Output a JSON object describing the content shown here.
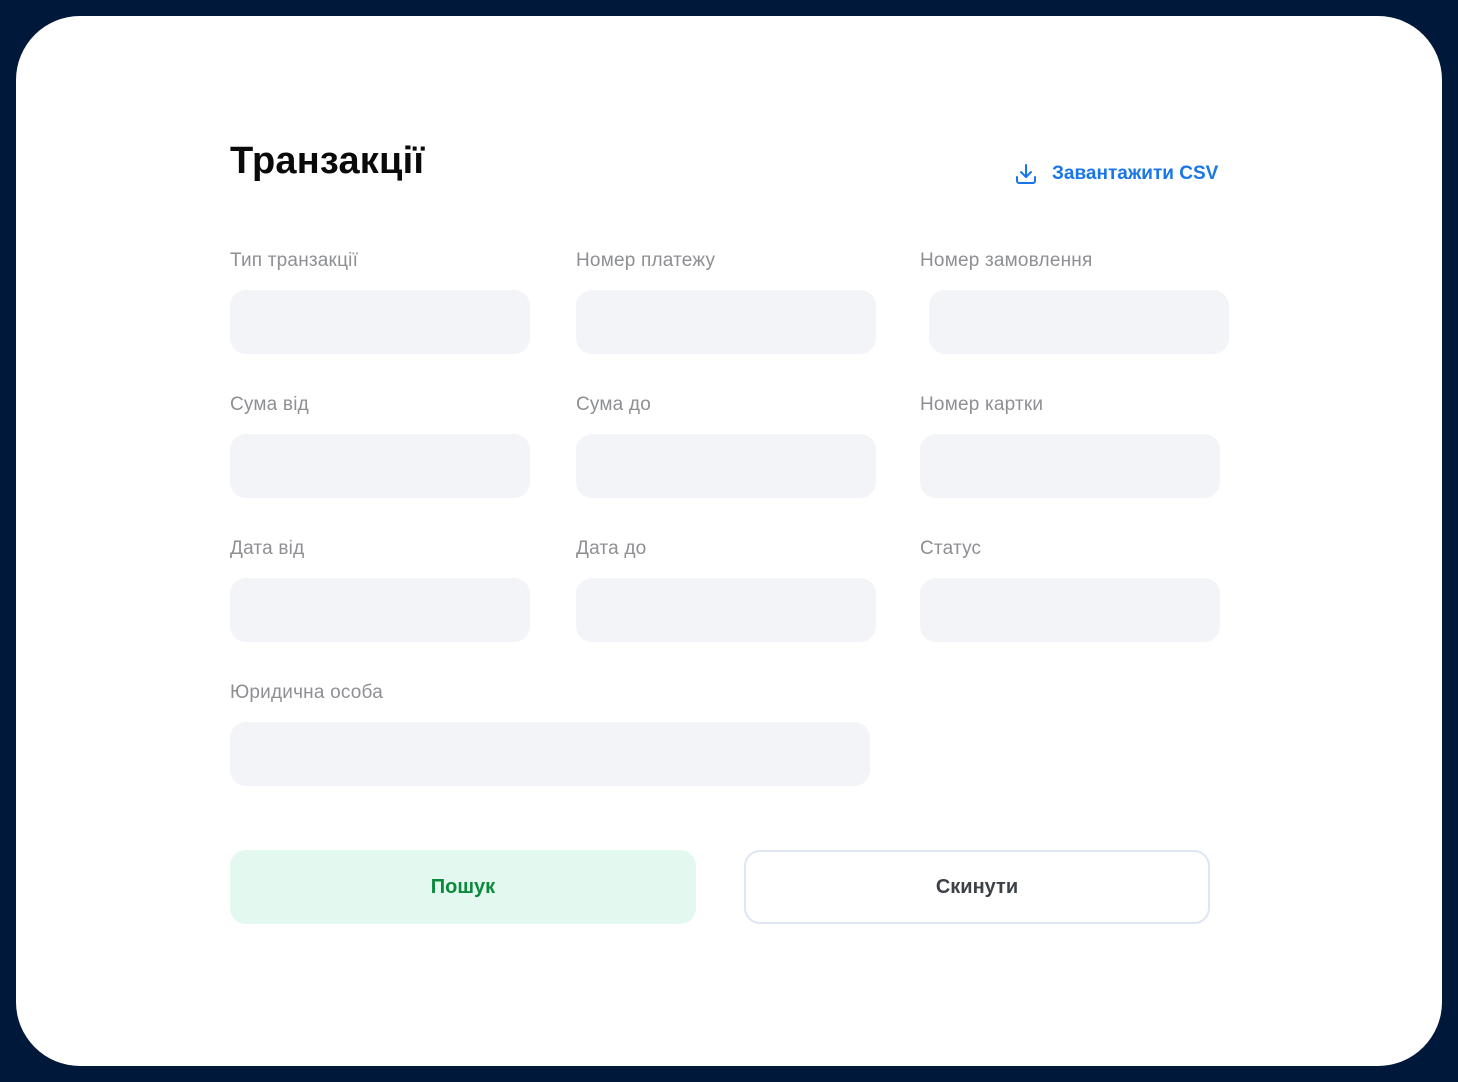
{
  "page": {
    "title": "Транзакції"
  },
  "actions": {
    "download_csv": {
      "label": "Завантажити CSV",
      "icon": "download-icon",
      "color": "#1a76e8"
    }
  },
  "filters": {
    "transaction_type": {
      "label": "Тип транзакції",
      "value": ""
    },
    "payment_number": {
      "label": "Номер платежу",
      "value": ""
    },
    "order_number": {
      "label": "Номер замовлення",
      "value": ""
    },
    "amount_from": {
      "label": "Сума від",
      "value": ""
    },
    "amount_to": {
      "label": "Сума до",
      "value": ""
    },
    "card_number": {
      "label": "Номер картки",
      "value": ""
    },
    "date_from": {
      "label": "Дата від",
      "value": ""
    },
    "date_to": {
      "label": "Дата до",
      "value": ""
    },
    "status": {
      "label": "Статус",
      "value": ""
    },
    "legal_entity": {
      "label": "Юридична особа",
      "value": ""
    }
  },
  "buttons": {
    "search": {
      "label": "Пошук",
      "color": "#0b8a3c",
      "background": "#e3f8ee"
    },
    "reset": {
      "label": "Скинути"
    }
  },
  "colors": {
    "frame": "#00183a",
    "card": "#ffffff",
    "input_background": "#f3f4f7",
    "label": "#8d8f93"
  }
}
